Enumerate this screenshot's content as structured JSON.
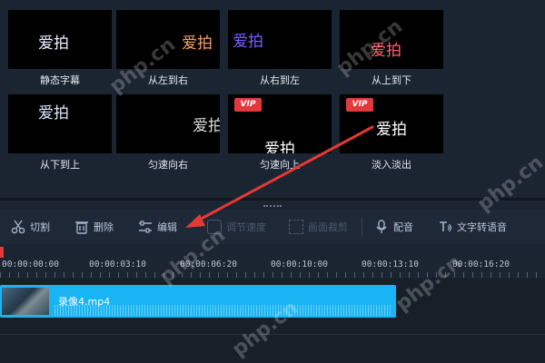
{
  "effects": [
    {
      "label": "静态字幕",
      "sample": "爱拍",
      "vip": false,
      "color": "#eaf2ff"
    },
    {
      "label": "从左到右",
      "sample": "爱拍",
      "vip": false,
      "color": "#ff9c5a"
    },
    {
      "label": "从右到左",
      "sample": "爱拍",
      "vip": false,
      "color": "#7a5cff"
    },
    {
      "label": "从上到下",
      "sample": "爱拍",
      "vip": false,
      "color": "#ff6070"
    },
    {
      "label": "从下到上",
      "sample": "爱拍",
      "vip": false,
      "color": "#dbe6ff"
    },
    {
      "label": "匀速向右",
      "sample": "爱拍",
      "vip": false,
      "color": "#d8d8d8"
    },
    {
      "label": "匀速向上",
      "sample": "爱拍",
      "vip": true,
      "color": "#ffffff"
    },
    {
      "label": "淡入淡出",
      "sample": "爱拍",
      "vip": true,
      "color": "#ffffff"
    }
  ],
  "vip_badge": "VIP",
  "toolbar": {
    "cut": "切割",
    "delete": "删除",
    "edit": "编辑",
    "disabled_a": "调节速度",
    "disabled_b": "画面裁剪",
    "dub": "配音",
    "tts": "文字转语音"
  },
  "ruler": {
    "labels": [
      "00:00:00:00",
      "00:00:03:10",
      "00:00:06:20",
      "00:00:10:00",
      "00:00:13:10",
      "00:00:16:20"
    ]
  },
  "clip": {
    "name": "录像4.mp4"
  },
  "watermark": "php.cn",
  "colors": {
    "background": "#1b2431",
    "clip": "#19b4f4",
    "arrow": "#e53935",
    "vip": "#e3383c"
  }
}
